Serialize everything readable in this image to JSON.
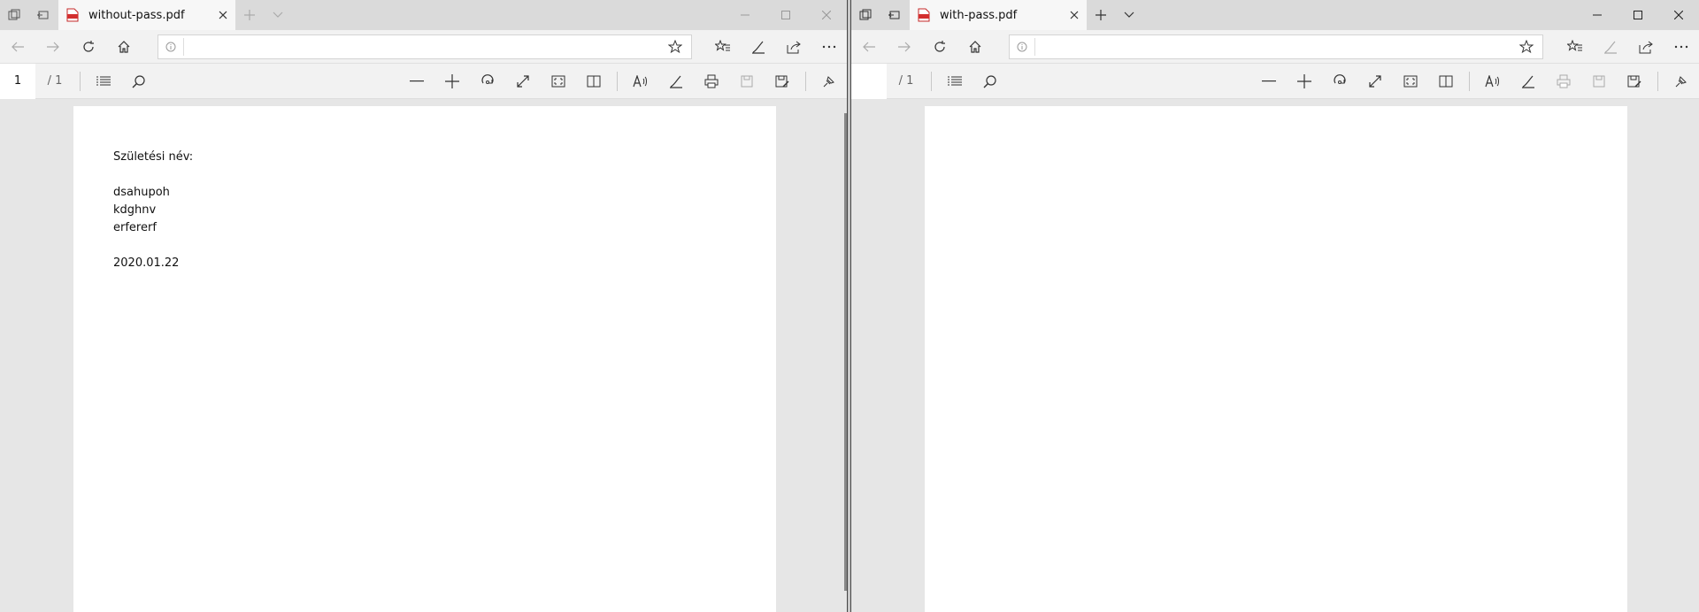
{
  "windows": [
    {
      "tab_title": "without-pass.pdf",
      "address_value": "",
      "page_input": "1",
      "page_total": "/ 1",
      "document": {
        "lines": [
          "Születési név:",
          "dsahupoh",
          "kdghnv",
          "erfererf",
          "2020.01.22"
        ]
      }
    },
    {
      "tab_title": "with-pass.pdf",
      "address_value": "",
      "page_input": "",
      "page_total": "/ 1",
      "document": {
        "lines": []
      }
    }
  ],
  "icons": {
    "window_controls": [
      "minimize-icon",
      "maximize-icon",
      "close-icon"
    ],
    "nav": [
      "back-arrow-icon",
      "forward-arrow-icon",
      "refresh-icon",
      "home-icon"
    ],
    "nav_right": [
      "favorites-icon",
      "notes-pen-icon",
      "share-icon",
      "more-icon"
    ],
    "pdf_toolbar": [
      "contents-icon",
      "search-icon",
      "zoom-out-icon",
      "zoom-in-icon",
      "rotate-icon",
      "fit-icon",
      "fullscreen-icon",
      "page-layout-icon",
      "read-aloud-icon",
      "draw-icon",
      "print-icon",
      "save-icon",
      "save-as-icon",
      "pin-toolbar-icon"
    ]
  },
  "colors": {
    "pdf_icon_red": "#d32f2f",
    "toolbar_bg": "#f2f2f2",
    "titlebar_bg": "#dadada"
  }
}
